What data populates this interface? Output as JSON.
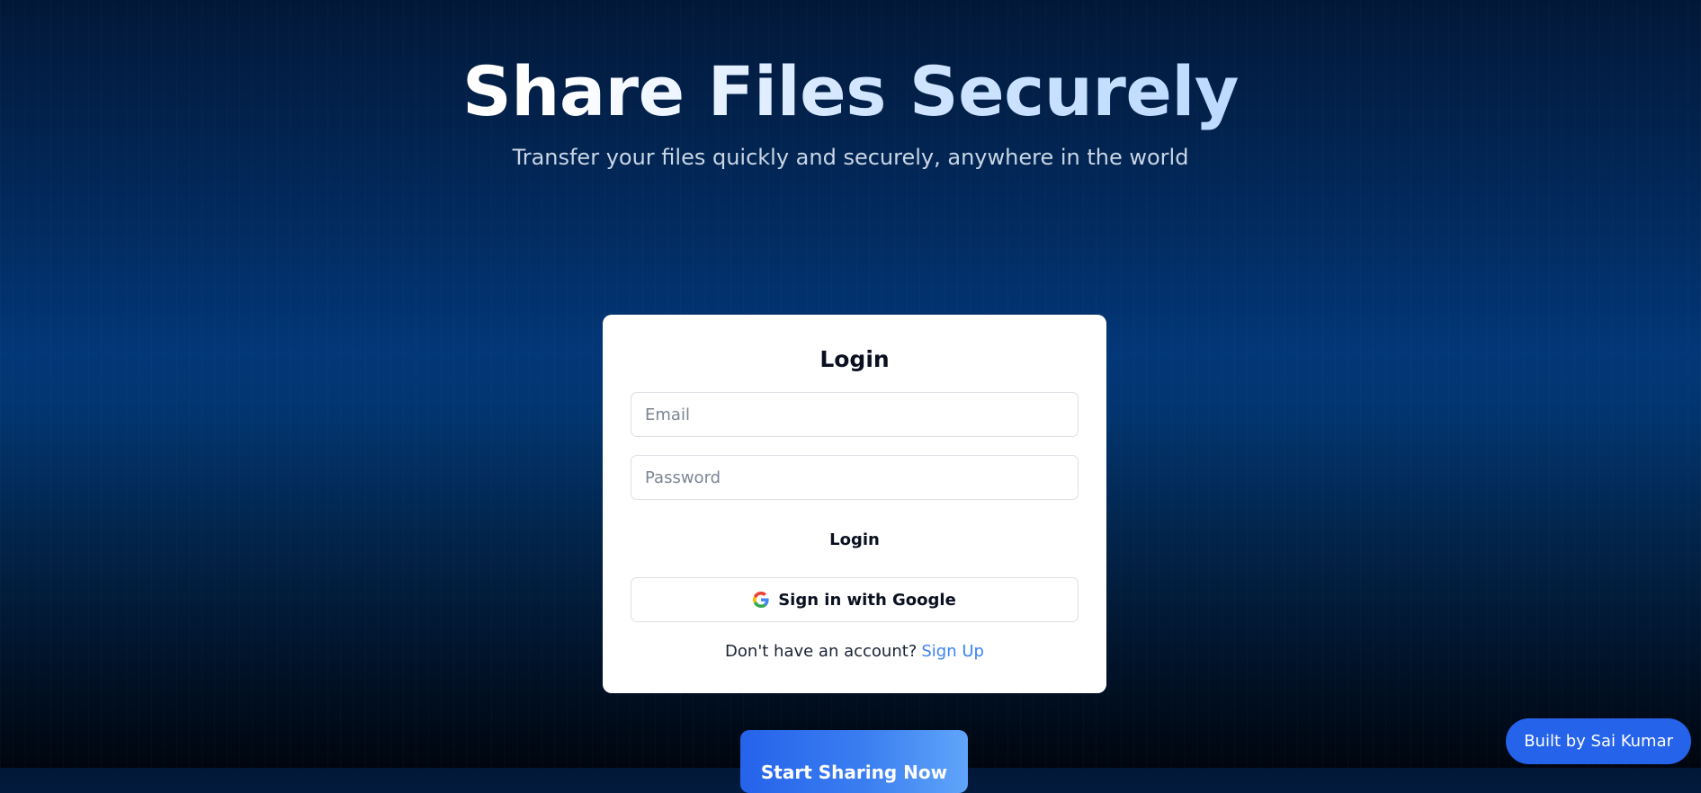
{
  "hero": {
    "title": "Share Files Securely",
    "subtitle": "Transfer your files quickly and securely, anywhere in the world"
  },
  "login_card": {
    "title": "Login",
    "email_placeholder": "Email",
    "email_value": "",
    "password_placeholder": "Password",
    "password_value": "",
    "login_label": "Login",
    "google_label": "Sign in with Google",
    "google_icon": "google-icon",
    "signup_prompt": "Don't have an account?",
    "signup_link_label": "Sign Up"
  },
  "cta": {
    "label": "Start Sharing Now"
  },
  "footer_badge": {
    "label": "Built by Sai Kumar"
  },
  "colors": {
    "accent": "#2563eb",
    "link": "#3b82f6",
    "background_top": "#021838",
    "background_mid": "#023778",
    "background_bottom": "#00060e"
  }
}
